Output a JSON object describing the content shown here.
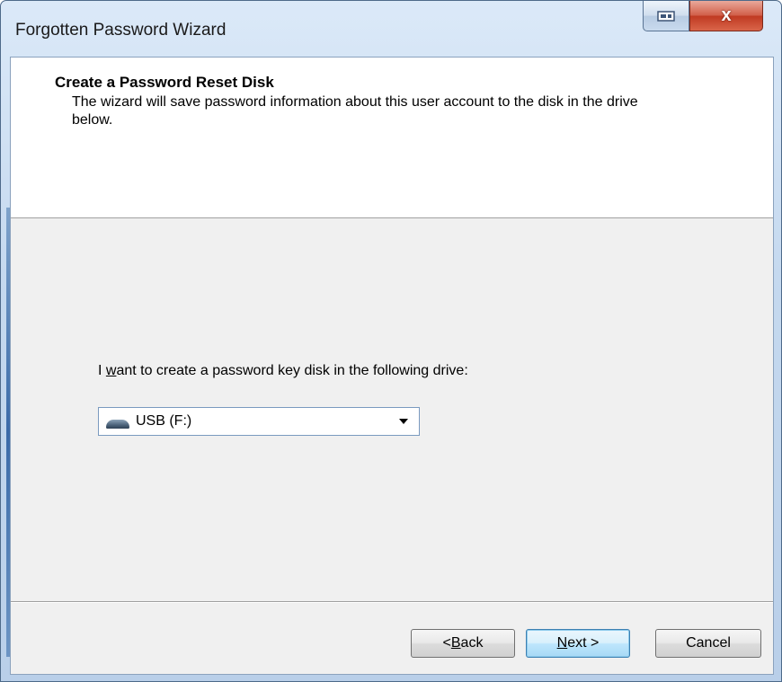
{
  "window": {
    "title": "Forgotten Password Wizard",
    "close_glyph": "x"
  },
  "header": {
    "heading": "Create a Password Reset Disk",
    "description": "The wizard will save password information about this user account to the disk in the drive below."
  },
  "drive_prompt": {
    "before": "I ",
    "accel": "w",
    "after": "ant to create a password key disk in the following drive:"
  },
  "drive_select": {
    "selected": "USB (F:)",
    "icon": "usb-drive-icon"
  },
  "buttons": {
    "back": {
      "prefix": "< ",
      "accel": "B",
      "rest": "ack"
    },
    "next": {
      "accel": "N",
      "rest": "ext >"
    },
    "cancel": "Cancel"
  },
  "colors": {
    "close_button": "#c8412a",
    "next_button_border": "#3c7fb1"
  }
}
